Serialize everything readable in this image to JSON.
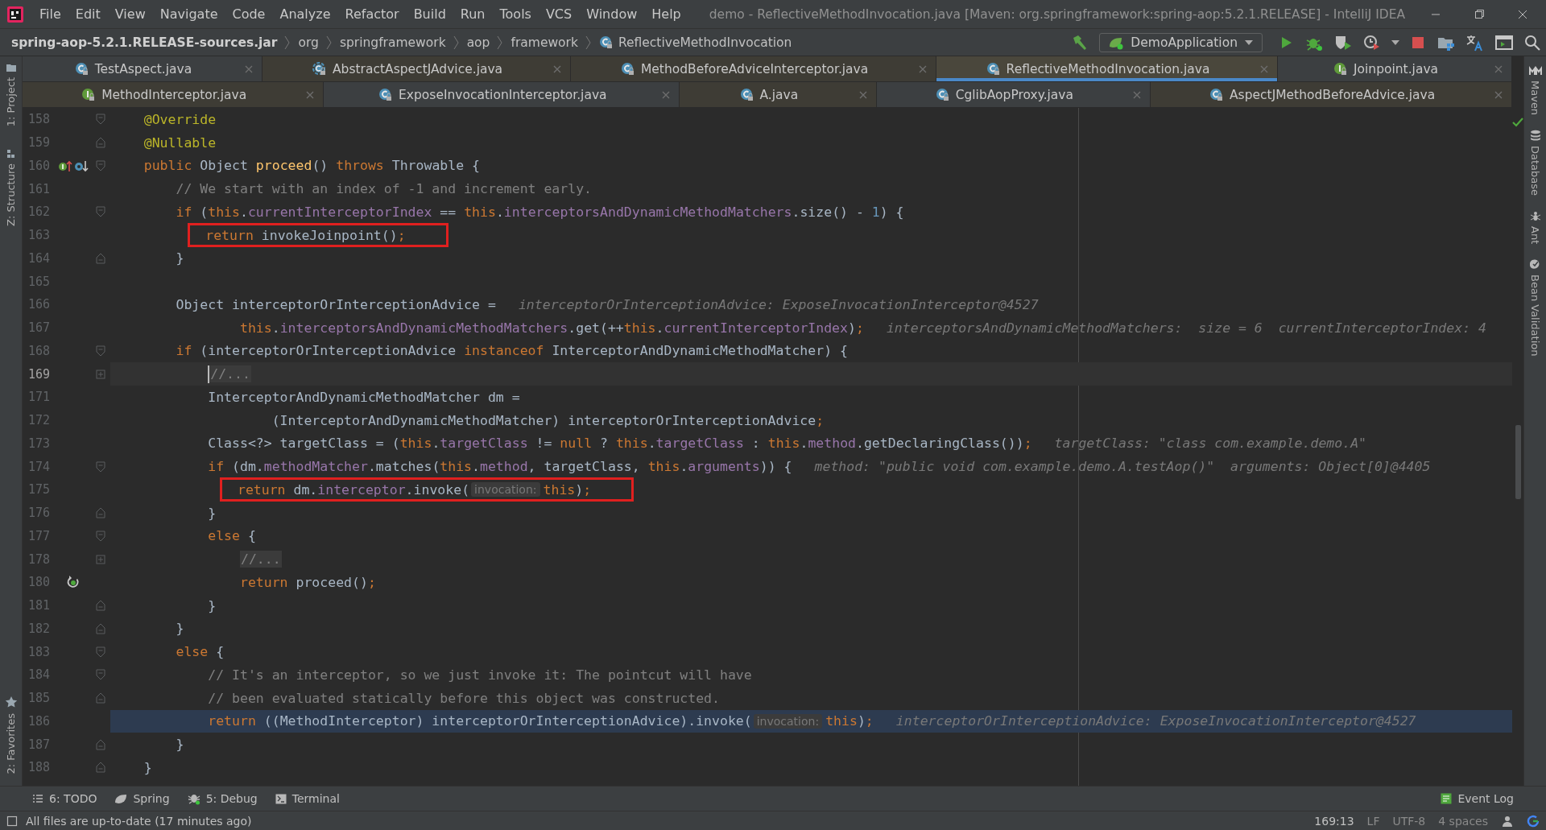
{
  "menu": [
    "File",
    "Edit",
    "View",
    "Navigate",
    "Code",
    "Analyze",
    "Refactor",
    "Build",
    "Run",
    "Tools",
    "VCS",
    "Window",
    "Help"
  ],
  "window_title": "demo - ReflectiveMethodInvocation.java [Maven: org.springframework:spring-aop:5.2.1.RELEASE] - IntelliJ IDEA",
  "breadcrumbs": [
    {
      "label": "spring-aop-5.2.1.RELEASE-sources.jar",
      "kind": "jar"
    },
    {
      "label": "org",
      "kind": "package"
    },
    {
      "label": "springframework",
      "kind": "package"
    },
    {
      "label": "aop",
      "kind": "package"
    },
    {
      "label": "framework",
      "kind": "package"
    },
    {
      "label": "ReflectiveMethodInvocation",
      "kind": "class"
    }
  ],
  "run_config": "DemoApplication",
  "tab_rows": [
    {
      "tabs": [
        {
          "label": "TestAspect.java",
          "kind": "class",
          "library": false,
          "selected": false
        },
        {
          "label": "AbstractAspectJAdvice.java",
          "kind": "abstract",
          "library": true,
          "selected": false
        },
        {
          "label": "MethodBeforeAdviceInterceptor.java",
          "kind": "class",
          "library": true,
          "selected": false
        },
        {
          "label": "ReflectiveMethodInvocation.java",
          "kind": "class",
          "library": true,
          "selected": true
        },
        {
          "label": "Joinpoint.java",
          "kind": "interface",
          "library": false,
          "selected": false
        }
      ]
    },
    {
      "tabs": [
        {
          "label": "MethodInterceptor.java",
          "kind": "interface",
          "library": true,
          "selected": false
        },
        {
          "label": "ExposeInvocationInterceptor.java",
          "kind": "class",
          "library": false,
          "selected": false
        },
        {
          "label": "A.java",
          "kind": "class",
          "library": true,
          "selected": false
        },
        {
          "label": "CglibAopProxy.java",
          "kind": "class",
          "library": false,
          "selected": false
        },
        {
          "label": "AspectJMethodBeforeAdvice.java",
          "kind": "class",
          "library": true,
          "selected": false
        }
      ]
    }
  ],
  "left_tools": [
    {
      "label": "1: Project",
      "kind": "folder"
    },
    {
      "label": "Z: Structure",
      "kind": "structure"
    },
    {
      "label": "2: Favorites",
      "kind": "star"
    }
  ],
  "right_tools": [
    {
      "label": "Maven",
      "kind": "maven"
    },
    {
      "label": "Database",
      "kind": "database"
    },
    {
      "label": "Ant",
      "kind": "ant"
    },
    {
      "label": "Bean Validation",
      "kind": "bean"
    }
  ],
  "lines": [
    {
      "n": "158",
      "fold": {
        "kind": "start"
      },
      "current": false,
      "execution_point": false,
      "boxed": false,
      "code": [
        {
          "kind": "annotation",
          "text": "    @Override"
        }
      ]
    },
    {
      "n": "159",
      "fold": {
        "kind": "end"
      },
      "current": false,
      "execution_point": false,
      "boxed": false,
      "code": [
        {
          "kind": "annotation",
          "text": "    @Nullable"
        }
      ]
    },
    {
      "n": "160",
      "fold": {
        "kind": "start"
      },
      "gutter": {
        "kind": "overrides"
      },
      "current": false,
      "execution_point": false,
      "boxed": false,
      "code": [
        {
          "kind": "keyword",
          "text": "    public"
        },
        {
          "kind": "plain",
          "text": " Object "
        },
        {
          "kind": "declaration",
          "text": "proceed"
        },
        {
          "kind": "plain",
          "text": "() "
        },
        {
          "kind": "keyword",
          "text": "throws"
        },
        {
          "kind": "plain",
          "text": " Throwable {"
        }
      ]
    },
    {
      "n": "161",
      "current": false,
      "execution_point": false,
      "boxed": false,
      "code": [
        {
          "kind": "comment",
          "text": "        // We start with an index of -1 and increment early."
        }
      ]
    },
    {
      "n": "162",
      "fold": {
        "kind": "start"
      },
      "current": false,
      "execution_point": false,
      "boxed": false,
      "code": [
        {
          "kind": "keyword",
          "text": "        if"
        },
        {
          "kind": "plain",
          "text": " ("
        },
        {
          "kind": "keyword",
          "text": "this"
        },
        {
          "kind": "plain",
          "text": "."
        },
        {
          "kind": "field",
          "text": "currentInterceptorIndex"
        },
        {
          "kind": "plain",
          "text": " == "
        },
        {
          "kind": "keyword",
          "text": "this"
        },
        {
          "kind": "plain",
          "text": "."
        },
        {
          "kind": "field",
          "text": "interceptorsAndDynamicMethodMatchers"
        },
        {
          "kind": "plain",
          "text": ".size() - "
        },
        {
          "kind": "number",
          "text": "1"
        },
        {
          "kind": "plain",
          "text": ") {"
        }
      ]
    },
    {
      "n": "163",
      "current": false,
      "execution_point": false,
      "boxed": true,
      "code": [
        {
          "kind": "keyword",
          "text": "            return"
        },
        {
          "kind": "plain",
          "text": " invokeJoinpoint()"
        },
        {
          "kind": "keyword",
          "text": ";"
        }
      ]
    },
    {
      "n": "164",
      "fold": {
        "kind": "end"
      },
      "current": false,
      "execution_point": false,
      "boxed": false,
      "code": [
        {
          "kind": "plain",
          "text": "        }"
        }
      ]
    },
    {
      "n": "165",
      "current": false,
      "execution_point": false,
      "boxed": false
    },
    {
      "n": "166",
      "current": false,
      "execution_point": false,
      "boxed": false,
      "code": [
        {
          "kind": "plain",
          "text": "        Object interceptorOrInterceptionAdvice ="
        },
        {
          "kind": "debug",
          "text": "interceptorOrInterceptionAdvice: ExposeInvocationInterceptor@4527"
        }
      ]
    },
    {
      "n": "167",
      "current": false,
      "execution_point": false,
      "boxed": false,
      "code": [
        {
          "kind": "keyword",
          "text": "                this"
        },
        {
          "kind": "plain",
          "text": "."
        },
        {
          "kind": "field",
          "text": "interceptorsAndDynamicMethodMatchers"
        },
        {
          "kind": "plain",
          "text": ".get(++"
        },
        {
          "kind": "keyword",
          "text": "this"
        },
        {
          "kind": "plain",
          "text": "."
        },
        {
          "kind": "field",
          "text": "currentInterceptorIndex"
        },
        {
          "kind": "plain",
          "text": ")"
        },
        {
          "kind": "keyword",
          "text": ";"
        },
        {
          "kind": "debug",
          "text": "interceptorsAndDynamicMethodMatchers:  size = 6  currentInterceptorIndex: 4"
        }
      ]
    },
    {
      "n": "168",
      "fold": {
        "kind": "start"
      },
      "current": false,
      "execution_point": false,
      "boxed": false,
      "code": [
        {
          "kind": "keyword",
          "text": "        if"
        },
        {
          "kind": "plain",
          "text": " (interceptorOrInterceptionAdvice "
        },
        {
          "kind": "keyword",
          "text": "instanceof"
        },
        {
          "kind": "plain",
          "text": " InterceptorAndDynamicMethodMatcher) {"
        }
      ]
    },
    {
      "n": "169",
      "fold": {
        "kind": "collapsed"
      },
      "current": true,
      "execution_point": false,
      "boxed": false,
      "code": [
        {
          "kind": "folded",
          "text": "            //..."
        }
      ]
    },
    {
      "n": "171",
      "current": false,
      "execution_point": false,
      "boxed": false,
      "code": [
        {
          "kind": "plain",
          "text": "            InterceptorAndDynamicMethodMatcher dm ="
        }
      ]
    },
    {
      "n": "172",
      "current": false,
      "execution_point": false,
      "boxed": false,
      "code": [
        {
          "kind": "plain",
          "text": "                    (InterceptorAndDynamicMethodMatcher) interceptorOrInterceptionAdvice"
        },
        {
          "kind": "keyword",
          "text": ";"
        }
      ]
    },
    {
      "n": "173",
      "current": false,
      "execution_point": false,
      "boxed": false,
      "code": [
        {
          "kind": "plain",
          "text": "            Class<?> targetClass = ("
        },
        {
          "kind": "keyword",
          "text": "this"
        },
        {
          "kind": "plain",
          "text": "."
        },
        {
          "kind": "field",
          "text": "targetClass"
        },
        {
          "kind": "plain",
          "text": " != "
        },
        {
          "kind": "keyword",
          "text": "null"
        },
        {
          "kind": "plain",
          "text": " ? "
        },
        {
          "kind": "keyword",
          "text": "this"
        },
        {
          "kind": "plain",
          "text": "."
        },
        {
          "kind": "field",
          "text": "targetClass"
        },
        {
          "kind": "plain",
          "text": " : "
        },
        {
          "kind": "keyword",
          "text": "this"
        },
        {
          "kind": "plain",
          "text": "."
        },
        {
          "kind": "field",
          "text": "method"
        },
        {
          "kind": "plain",
          "text": ".getDeclaringClass())"
        },
        {
          "kind": "keyword",
          "text": ";"
        },
        {
          "kind": "debug",
          "text": "targetClass: \"class com.example.demo.A\""
        }
      ]
    },
    {
      "n": "174",
      "fold": {
        "kind": "start"
      },
      "current": false,
      "execution_point": false,
      "boxed": false,
      "code": [
        {
          "kind": "keyword",
          "text": "            if"
        },
        {
          "kind": "plain",
          "text": " (dm."
        },
        {
          "kind": "field",
          "text": "methodMatcher"
        },
        {
          "kind": "plain",
          "text": ".matches("
        },
        {
          "kind": "keyword",
          "text": "this"
        },
        {
          "kind": "plain",
          "text": "."
        },
        {
          "kind": "field",
          "text": "method"
        },
        {
          "kind": "plain",
          "text": ", targetClass, "
        },
        {
          "kind": "keyword",
          "text": "this"
        },
        {
          "kind": "plain",
          "text": "."
        },
        {
          "kind": "field",
          "text": "arguments"
        },
        {
          "kind": "plain",
          "text": ")) {"
        },
        {
          "kind": "debug",
          "text": "method: \"public void com.example.demo.A.testAop()\"  arguments: Object[0]@4405"
        }
      ]
    },
    {
      "n": "175",
      "current": false,
      "execution_point": false,
      "boxed": true,
      "code": [
        {
          "kind": "keyword",
          "text": "                return"
        },
        {
          "kind": "plain",
          "text": " dm."
        },
        {
          "kind": "field",
          "text": "interceptor"
        },
        {
          "kind": "plain",
          "text": ".invoke("
        },
        {
          "kind": "hint",
          "text": "invocation:"
        },
        {
          "kind": "keyword",
          "text": "this"
        },
        {
          "kind": "plain",
          "text": ")"
        },
        {
          "kind": "keyword",
          "text": ";"
        }
      ]
    },
    {
      "n": "176",
      "fold": {
        "kind": "end"
      },
      "current": false,
      "execution_point": false,
      "boxed": false,
      "code": [
        {
          "kind": "plain",
          "text": "            }"
        }
      ]
    },
    {
      "n": "177",
      "fold": {
        "kind": "start"
      },
      "current": false,
      "execution_point": false,
      "boxed": false,
      "code": [
        {
          "kind": "keyword",
          "text": "            else"
        },
        {
          "kind": "plain",
          "text": " {"
        }
      ]
    },
    {
      "n": "178",
      "fold": {
        "kind": "collapsed"
      },
      "current": false,
      "execution_point": false,
      "boxed": false,
      "code": [
        {
          "kind": "folded",
          "text": "                //..."
        }
      ]
    },
    {
      "n": "180",
      "gutter": {
        "kind": "recursion"
      },
      "current": false,
      "execution_point": false,
      "boxed": false,
      "code": [
        {
          "kind": "keyword",
          "text": "                return"
        },
        {
          "kind": "plain",
          "text": " proceed()"
        },
        {
          "kind": "keyword",
          "text": ";"
        }
      ]
    },
    {
      "n": "181",
      "fold": {
        "kind": "end"
      },
      "current": false,
      "execution_point": false,
      "boxed": false,
      "code": [
        {
          "kind": "plain",
          "text": "            }"
        }
      ]
    },
    {
      "n": "182",
      "fold": {
        "kind": "end"
      },
      "current": false,
      "execution_point": false,
      "boxed": false,
      "code": [
        {
          "kind": "plain",
          "text": "        }"
        }
      ]
    },
    {
      "n": "183",
      "fold": {
        "kind": "start"
      },
      "current": false,
      "execution_point": false,
      "boxed": false,
      "code": [
        {
          "kind": "keyword",
          "text": "        else"
        },
        {
          "kind": "plain",
          "text": " {"
        }
      ]
    },
    {
      "n": "184",
      "fold": {
        "kind": "start"
      },
      "current": false,
      "execution_point": false,
      "boxed": false,
      "code": [
        {
          "kind": "comment",
          "text": "            // It's an interceptor, so we just invoke it: The pointcut will have"
        }
      ]
    },
    {
      "n": "185",
      "fold": {
        "kind": "end"
      },
      "current": false,
      "execution_point": false,
      "boxed": false,
      "code": [
        {
          "kind": "comment",
          "text": "            // been evaluated statically before this object was constructed."
        }
      ]
    },
    {
      "n": "186",
      "current": false,
      "execution_point": true,
      "boxed": false,
      "code": [
        {
          "kind": "keyword",
          "text": "            return"
        },
        {
          "kind": "plain",
          "text": " ((MethodInterceptor) interceptorOrInterceptionAdvice).invoke("
        },
        {
          "kind": "hint",
          "text": "invocation:"
        },
        {
          "kind": "keyword",
          "text": "this"
        },
        {
          "kind": "plain",
          "text": ")"
        },
        {
          "kind": "keyword",
          "text": ";"
        },
        {
          "kind": "debug",
          "text": "interceptorOrInterceptionAdvice: ExposeInvocationInterceptor@4527"
        }
      ]
    },
    {
      "n": "187",
      "fold": {
        "kind": "end"
      },
      "current": false,
      "execution_point": false,
      "boxed": false,
      "code": [
        {
          "kind": "plain",
          "text": "        }"
        }
      ]
    },
    {
      "n": "188",
      "fold": {
        "kind": "end"
      },
      "current": false,
      "execution_point": false,
      "boxed": false,
      "code": [
        {
          "kind": "plain",
          "text": "    }"
        }
      ]
    }
  ],
  "bottom_tools": [
    {
      "label": "6: TODO",
      "kind": "list"
    },
    {
      "label": "Spring",
      "kind": "leaf"
    },
    {
      "label": "5: Debug",
      "kind": "bug"
    },
    {
      "label": "Terminal",
      "kind": "terminal"
    }
  ],
  "event_log": "Event Log",
  "status": {
    "message": "All files are up-to-date (17 minutes ago)",
    "position": "169:13",
    "line_separator": "LF",
    "encoding": "UTF-8",
    "indent": "4 spaces"
  }
}
